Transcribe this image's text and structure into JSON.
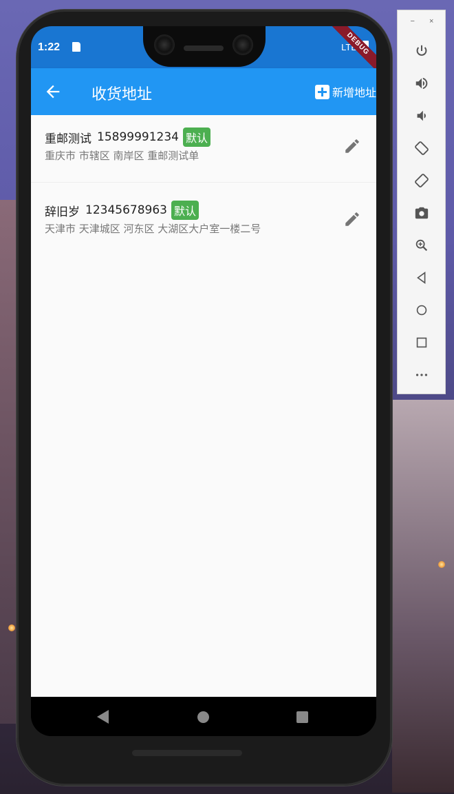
{
  "status_bar": {
    "time": "1:22",
    "network": "LTE",
    "debug_banner": "DEBUG"
  },
  "app_bar": {
    "title": "收货地址",
    "add_label": "新增地址"
  },
  "addresses": [
    {
      "name": "重邮测试",
      "phone": "15899991234",
      "tag": "默认",
      "address": "重庆市 市辖区 南岸区 重邮测试单"
    },
    {
      "name": "辞旧岁",
      "phone": "12345678963",
      "tag": "默认",
      "address": "天津市 天津城区 河东区 大湖区大户室一楼二号"
    }
  ],
  "emulator_panel": {
    "minimize": "−",
    "close": "×",
    "buttons": [
      "power-icon",
      "volume-up-icon",
      "volume-down-icon",
      "rotate-left-icon",
      "rotate-right-icon",
      "camera-icon",
      "zoom-icon",
      "back-icon",
      "home-icon",
      "overview-icon",
      "more-icon"
    ]
  },
  "colors": {
    "app_bar": "#2196f3",
    "status_bar": "#1976d2",
    "tag": "#4caf50"
  }
}
